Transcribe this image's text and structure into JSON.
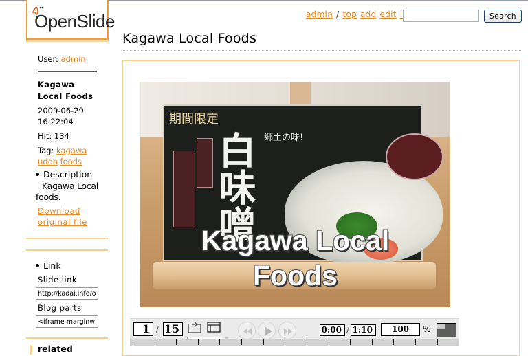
{
  "app": {
    "logo_text": "OpenSlide",
    "brand_color": "#f59a32",
    "link_color": "#f08a1c"
  },
  "topnav": {
    "user_link": "admin",
    "separator": "/",
    "links": [
      "top",
      "add",
      "edit",
      "list"
    ],
    "search": {
      "value": "",
      "placeholder": "",
      "button_label": "Search"
    }
  },
  "page": {
    "title": "Kagawa Local Foods"
  },
  "sidebar": {
    "user_label": "User:",
    "user_name": "admin",
    "slide_title": "Kagawa Local Foods",
    "date": "2009-06-29",
    "time": "16:22:04",
    "hit_label": "Hit:",
    "hit_count": "134",
    "tag_label": "Tag:",
    "tags": [
      "kagawa",
      "udon",
      "foods"
    ],
    "description_heading": "Description",
    "description_text": "Kagawa Local foods.",
    "download_label": "Download original file",
    "link_heading": "Link",
    "slide_link_label": "Slide link",
    "slide_link_value": "http://kadai.info/o",
    "blog_parts_label": "Blog parts",
    "blog_parts_value": "<iframe marginwidtl",
    "related_heading": "related"
  },
  "slide": {
    "caption_line1": "Kagawa Local",
    "caption_line2": "Foods",
    "jp_period": "期間限定",
    "jp_main": "白味噌",
    "jp_sub": "郷土の味!",
    "image_description": "Photo of a menu sign for white miso zoni udon on a wooden table"
  },
  "player": {
    "current_page": "1",
    "total_pages": "15",
    "page_separator": "/",
    "current_time": "0:00",
    "total_time": "1:10",
    "time_separator": "/",
    "zoom_value": "100",
    "zoom_unit": "%",
    "icons": [
      "return-icon",
      "window-icon",
      "rewind-icon",
      "play-icon",
      "fast-forward-icon",
      "fit-screen-icon"
    ]
  }
}
